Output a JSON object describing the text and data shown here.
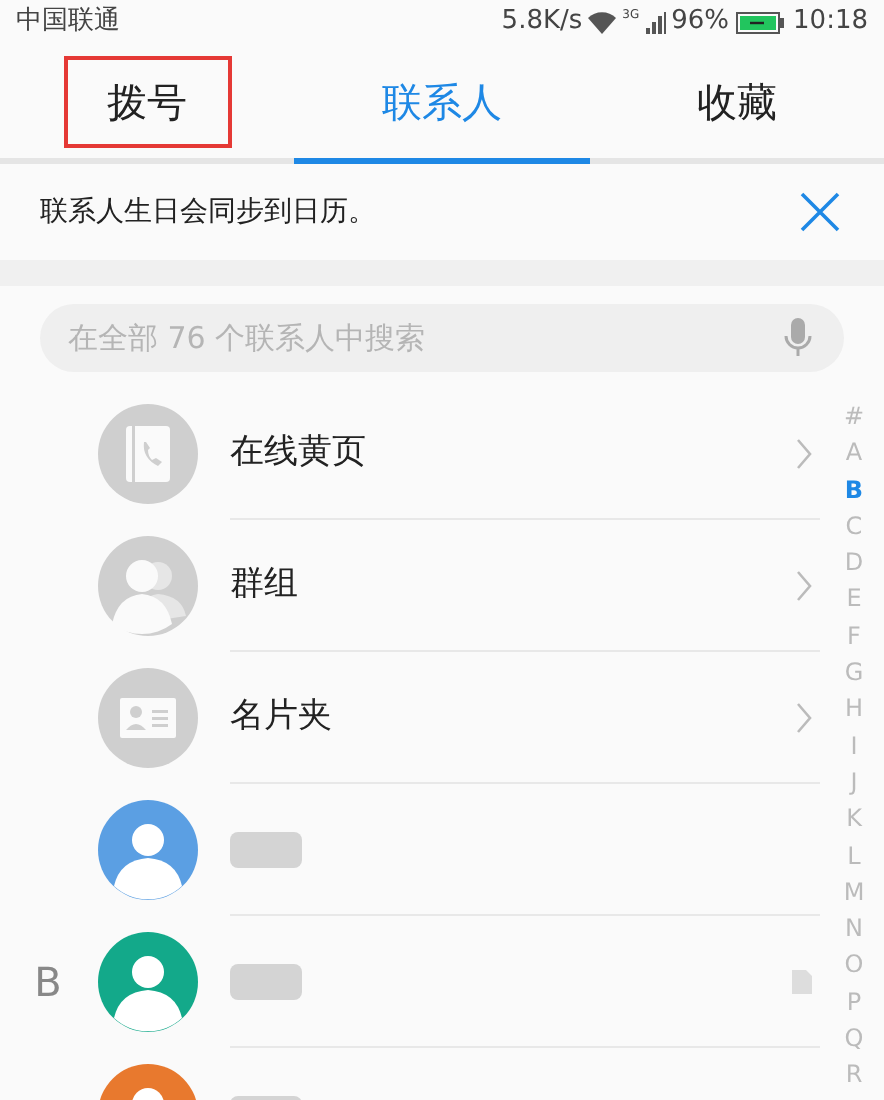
{
  "status_bar": {
    "carrier": "中国联通",
    "speed": "5.8K/s",
    "network": "3G",
    "battery": "96%",
    "time": "10:18"
  },
  "tabs": [
    {
      "label": "拨号",
      "selected": false,
      "highlighted": true
    },
    {
      "label": "联系人",
      "selected": true,
      "highlighted": false
    },
    {
      "label": "收藏",
      "selected": false,
      "highlighted": false
    }
  ],
  "banner": {
    "text": "联系人生日会同步到日历。"
  },
  "search": {
    "placeholder": "在全部 76 个联系人中搜索"
  },
  "rows": [
    {
      "kind": "yellow_pages",
      "name": "在线黄页"
    },
    {
      "kind": "groups",
      "name": "群组"
    },
    {
      "kind": "cards",
      "name": "名片夹"
    },
    {
      "kind": "contact",
      "color": "#5b9fe3"
    },
    {
      "kind": "contact",
      "color": "#13a98a",
      "section": "B",
      "has_note": true
    },
    {
      "kind": "contact",
      "color": "#e8792e"
    }
  ],
  "index": [
    {
      "letter": "#",
      "selected": false
    },
    {
      "letter": "A",
      "selected": false
    },
    {
      "letter": "B",
      "selected": true
    },
    {
      "letter": "C",
      "selected": false
    },
    {
      "letter": "D",
      "selected": false
    },
    {
      "letter": "E",
      "selected": false
    },
    {
      "letter": "F",
      "selected": false
    },
    {
      "letter": "G",
      "selected": false
    },
    {
      "letter": "H",
      "selected": false
    },
    {
      "letter": "I",
      "selected": false
    },
    {
      "letter": "J",
      "selected": false
    },
    {
      "letter": "K",
      "selected": false
    },
    {
      "letter": "L",
      "selected": false
    },
    {
      "letter": "M",
      "selected": false
    },
    {
      "letter": "N",
      "selected": false
    },
    {
      "letter": "O",
      "selected": false
    },
    {
      "letter": "P",
      "selected": false
    },
    {
      "letter": "Q",
      "selected": false
    },
    {
      "letter": "R",
      "selected": false
    }
  ]
}
